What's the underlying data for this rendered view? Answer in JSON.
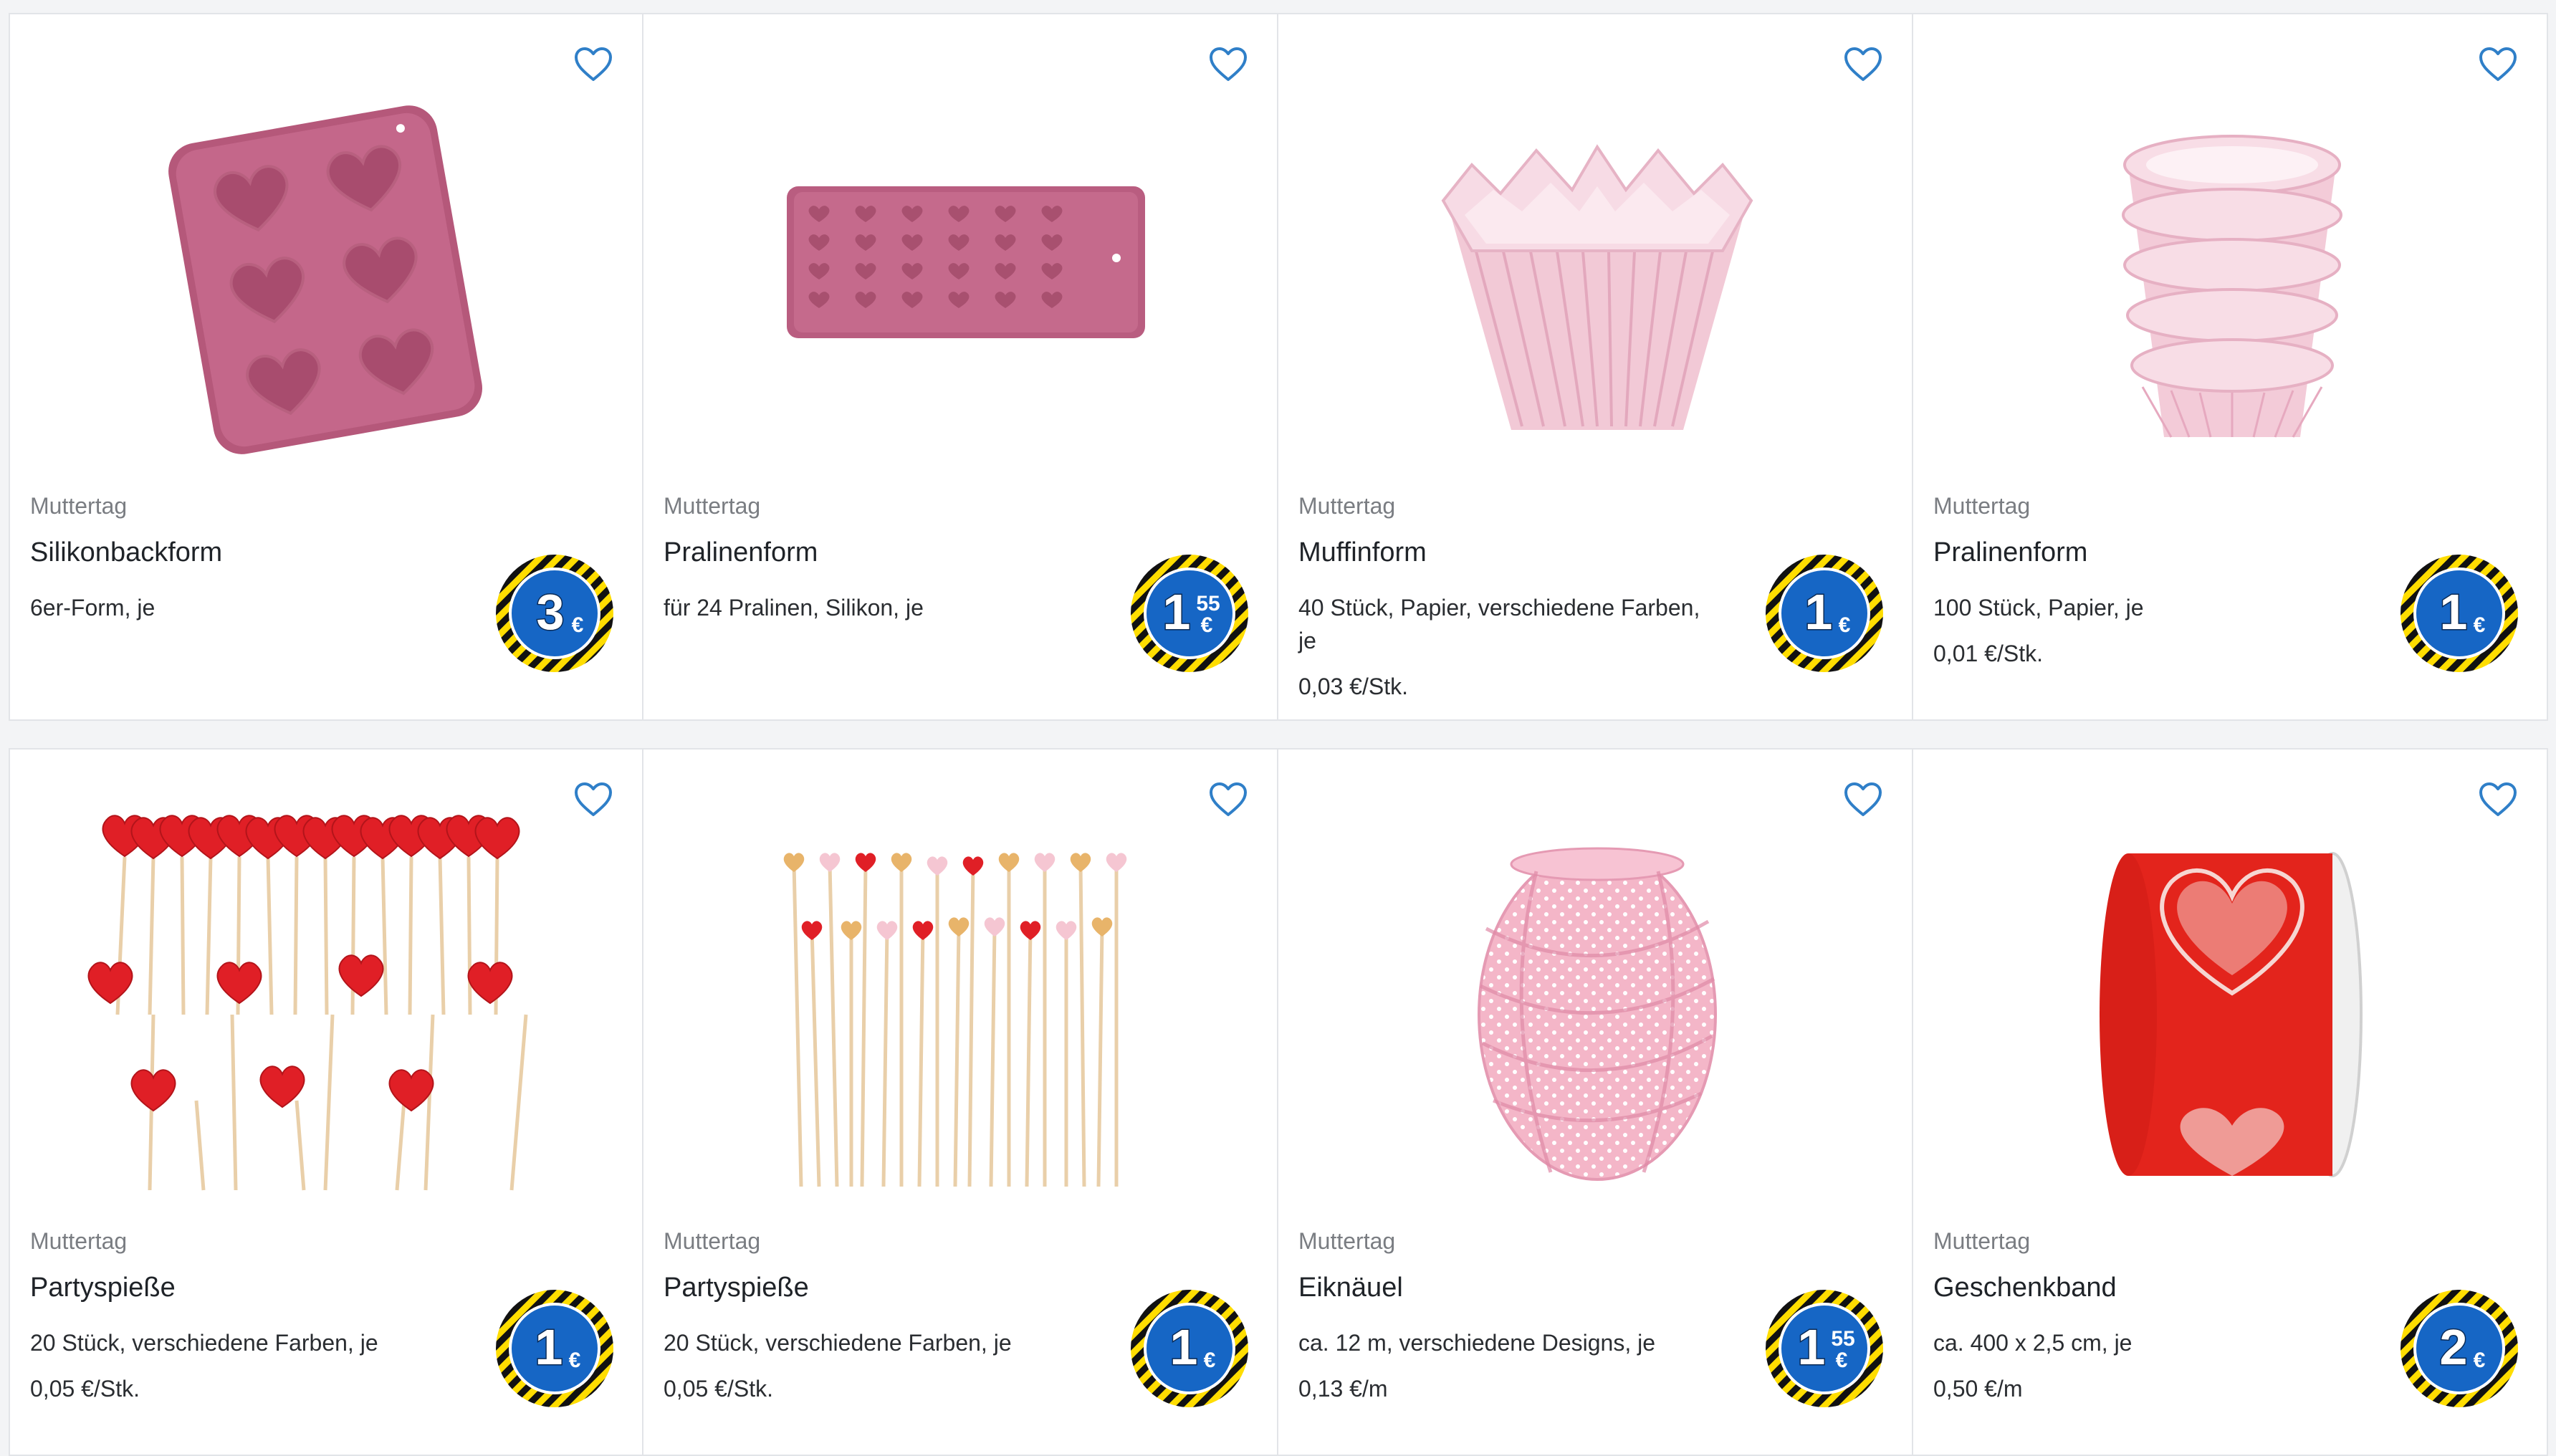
{
  "colors": {
    "accent_blue": "#1666c5",
    "badge_yellow": "#ffdd00",
    "badge_black": "#111111",
    "heart_outline": "#2f7fc8"
  },
  "products": [
    {
      "category": "Muttertag",
      "title": "Silikonbackform",
      "description": "6er-Form, je",
      "unit_price": "",
      "price": {
        "euro": "3",
        "cents": "",
        "currency": "€"
      },
      "image": "silicone-heart-baking-mold",
      "favorite_icon": "heart-outline-icon"
    },
    {
      "category": "Muttertag",
      "title": "Pralinenform",
      "description": "für 24 Pralinen, Silikon, je",
      "unit_price": "",
      "price": {
        "euro": "1",
        "cents": "55",
        "currency": "€"
      },
      "image": "silicone-praline-mold",
      "favorite_icon": "heart-outline-icon"
    },
    {
      "category": "Muttertag",
      "title": "Muffinform",
      "description": "40 Stück, Papier, verschiedene Farben, je",
      "unit_price": "0,03 €/Stk.",
      "price": {
        "euro": "1",
        "cents": "",
        "currency": "€"
      },
      "image": "paper-muffin-cups",
      "favorite_icon": "heart-outline-icon"
    },
    {
      "category": "Muttertag",
      "title": "Pralinenform",
      "description": "100 Stück, Papier, je",
      "unit_price": "0,01 €/Stk.",
      "price": {
        "euro": "1",
        "cents": "",
        "currency": "€"
      },
      "image": "paper-praline-cups",
      "favorite_icon": "heart-outline-icon"
    },
    {
      "category": "Muttertag",
      "title": "Partyspieße",
      "description": "20 Stück, verschiedene Farben, je",
      "unit_price": "0,05 €/Stk.",
      "price": {
        "euro": "1",
        "cents": "",
        "currency": "€"
      },
      "image": "red-heart-party-picks",
      "favorite_icon": "heart-outline-icon"
    },
    {
      "category": "Muttertag",
      "title": "Partyspieße",
      "description": "20 Stück, verschiedene Farben, je",
      "unit_price": "0,05 €/Stk.",
      "price": {
        "euro": "1",
        "cents": "",
        "currency": "€"
      },
      "image": "colored-heart-party-picks",
      "favorite_icon": "heart-outline-icon"
    },
    {
      "category": "Muttertag",
      "title": "Eiknäuel",
      "description": "ca. 12 m, verschiedene Designs, je",
      "unit_price": "0,13 €/m",
      "price": {
        "euro": "1",
        "cents": "55",
        "currency": "€"
      },
      "image": "pink-dotted-ribbon-egg",
      "favorite_icon": "heart-outline-icon"
    },
    {
      "category": "Muttertag",
      "title": "Geschenkband",
      "description": "ca. 400 x 2,5 cm, je",
      "unit_price": "0,50 €/m",
      "price": {
        "euro": "2",
        "cents": "",
        "currency": "€"
      },
      "image": "red-heart-gift-ribbon",
      "favorite_icon": "heart-outline-icon"
    }
  ]
}
